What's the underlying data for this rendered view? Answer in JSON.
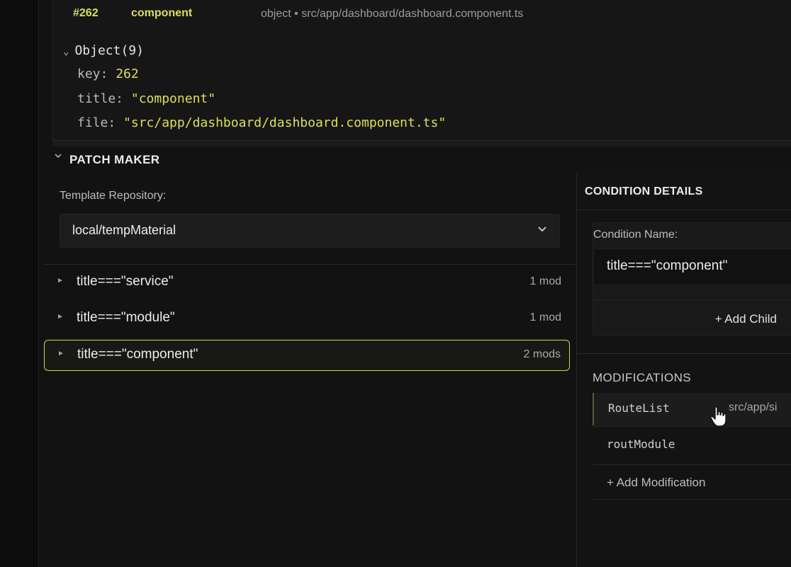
{
  "inspector": {
    "node_id": "#262",
    "node_title": "component",
    "node_meta": "object • src/app/dashboard/dashboard.component.ts",
    "object_label": "Object(9)",
    "props": [
      {
        "key": "key:",
        "value": "262"
      },
      {
        "key": "title:",
        "value": "\"component\""
      },
      {
        "key": "file:",
        "value": "\"src/app/dashboard/dashboard.component.ts\""
      }
    ]
  },
  "patch_maker": {
    "title": "PATCH MAKER",
    "repo_label": "Template Repository:",
    "repo_value": "local/tempMaterial",
    "conditions": [
      {
        "label": "title===\"service\"",
        "mods": "1 mod"
      },
      {
        "label": "title===\"module\"",
        "mods": "1 mod"
      },
      {
        "label": "title===\"component\"",
        "mods": "2 mods",
        "selected": true
      }
    ]
  },
  "condition_details": {
    "title": "CONDITION DETAILS",
    "name_label": "Condition Name:",
    "name_value": "title===\"component\"",
    "add_child": "+ Add Child",
    "mods_title": "MODIFICATIONS",
    "modifications": [
      {
        "name": "RouteList",
        "path": "src/app/si"
      },
      {
        "name": "routModule",
        "path": ""
      }
    ],
    "add_modification": "+ Add Modification"
  },
  "colors": {
    "accent": "#d9e24a",
    "selected_border": "#cbd64a",
    "background": "#121212"
  },
  "icons": [
    "chevron-down-icon",
    "caret-right-icon",
    "pointer-hand-icon"
  ]
}
